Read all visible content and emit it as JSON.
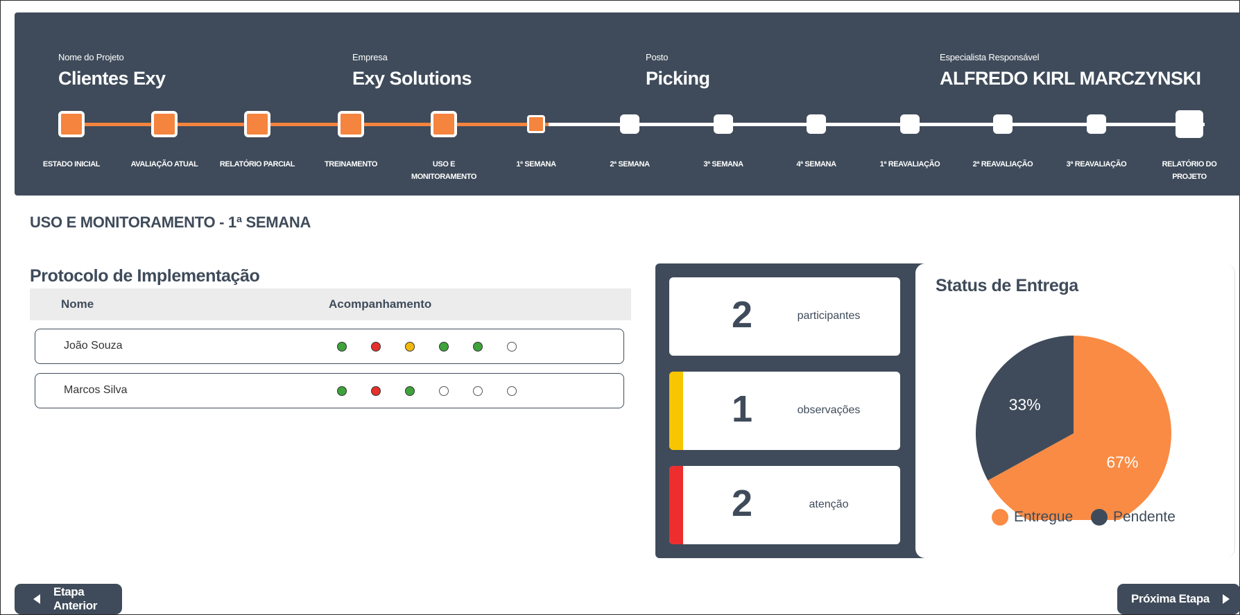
{
  "header": {
    "project": {
      "label": "Nome do Projeto",
      "value": "Clientes Exy"
    },
    "company": {
      "label": "Empresa",
      "value": "Exy Solutions"
    },
    "post": {
      "label": "Posto",
      "value": "Picking"
    },
    "specialist": {
      "label": "Especialista Responsável",
      "value": "ALFREDO KIRL MARCZYNSKI"
    }
  },
  "stepper": {
    "completed_steps": 6,
    "total_steps": 13,
    "current_step": "1ª SEMANA",
    "steps": [
      {
        "label": "ESTADO INICIAL",
        "status": "done"
      },
      {
        "label": "AVALIAÇÃO ATUAL",
        "status": "done"
      },
      {
        "label": "RELATÓRIO PARCIAL",
        "status": "done"
      },
      {
        "label": "TREINAMENTO",
        "status": "done"
      },
      {
        "label": "USO E MONITORAMENTO",
        "status": "done"
      },
      {
        "label": "1ª SEMANA",
        "status": "current"
      },
      {
        "label": "2ª SEMANA",
        "status": "todo"
      },
      {
        "label": "3ª SEMANA",
        "status": "todo"
      },
      {
        "label": "4ª SEMANA",
        "status": "todo"
      },
      {
        "label": "1ª REAVALIAÇÃO",
        "status": "todo"
      },
      {
        "label": "2ª REAVALIAÇÃO",
        "status": "todo"
      },
      {
        "label": "3ª REAVALIAÇÃO",
        "status": "todo"
      },
      {
        "label": "RELATÓRIO DO PROJETO",
        "status": "todo"
      }
    ]
  },
  "page_title": "USO E MONITORAMENTO - 1ª SEMANA",
  "protocol": {
    "title": "Protocolo de Implementação",
    "columns": [
      "Nome",
      "Acompanhamento"
    ],
    "rows": [
      {
        "name": "João Souza",
        "tracking": [
          "green",
          "red",
          "yellow",
          "green",
          "green",
          "empty"
        ]
      },
      {
        "name": "Marcos Silva",
        "tracking": [
          "green",
          "red",
          "green",
          "empty",
          "empty",
          "empty"
        ]
      }
    ]
  },
  "stats": [
    {
      "value": "2",
      "label": "participantes",
      "accent": ""
    },
    {
      "value": "1",
      "label": "observações",
      "accent": "#f7c600"
    },
    {
      "value": "2",
      "label": "atenção",
      "accent": "#ee2e2e"
    }
  ],
  "status": {
    "title": "Status de Entrega",
    "slices": [
      {
        "name": "Entregue",
        "value": 67,
        "label": "67%",
        "color": "#f98b44"
      },
      {
        "name": "Pendente",
        "value": 33,
        "label": "33%",
        "color": "#3f4b5a"
      }
    ]
  },
  "footer": {
    "prev_label": "Etapa Anterior",
    "next_label": "Próxima Etapa"
  },
  "colors": {
    "primary": "#3f4b5a",
    "accent": "#f5843e",
    "green": "#3ea33b",
    "red": "#e6302b",
    "yellow": "#f2b90c"
  },
  "icons": {
    "prev": "caret-left-icon",
    "next": "caret-right-icon"
  }
}
